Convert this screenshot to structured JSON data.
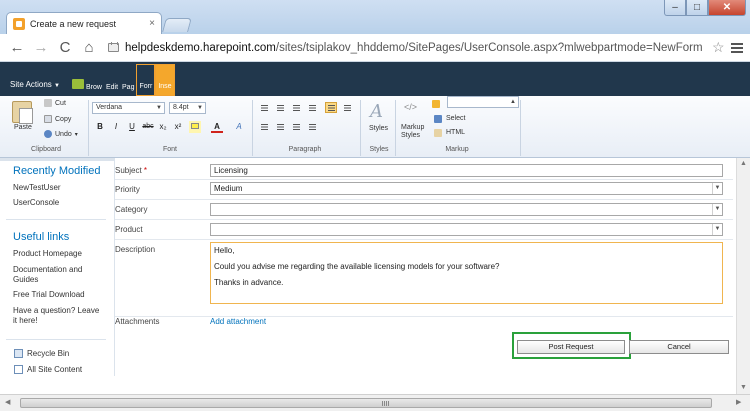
{
  "browser": {
    "tab_title": "Create a new request",
    "tab_close": "×",
    "url_host": "helpdeskdemo.harepoint.com",
    "url_path": "/sites/tsiplakov_hhddemo/SitePages/UserConsole.aspx?mlwebpartmode=NewForm",
    "back_glyph": "←",
    "forward_glyph": "→",
    "reload_glyph": "C",
    "home_glyph": "⌂",
    "star_glyph": "☆",
    "minimize_glyph": "–",
    "maximize_glyph": "□",
    "close_glyph": "✕"
  },
  "ribbon": {
    "site_actions": "Site Actions",
    "tabs": [
      {
        "label": "Brow"
      },
      {
        "label": "Edit"
      },
      {
        "label": "Pag"
      },
      {
        "label": "Forr"
      },
      {
        "label": "Inse"
      }
    ],
    "clipboard": {
      "paste": "Paste",
      "cut": "Cut",
      "copy": "Copy",
      "undo": "Undo",
      "group_label": "Clipboard"
    },
    "font": {
      "family": "Verdana",
      "size": "8.4pt",
      "bold": "B",
      "italic": "I",
      "underline": "U",
      "strike": "abc",
      "subscript": "x₂",
      "superscript": "x²",
      "font_color": "A",
      "clear": "A",
      "group_label": "Font"
    },
    "paragraph": {
      "group_label": "Paragraph"
    },
    "styles": {
      "label": "Styles",
      "group_label": "Styles"
    },
    "markup": {
      "markup_styles": "Markup",
      "markup_styles2": "Styles",
      "select": "Select",
      "html": "HTML",
      "group_label": "Markup"
    }
  },
  "quicklaunch": {
    "recently_modified_heading": "Recently Modified",
    "recent_items": [
      "NewTestUser",
      "UserConsole"
    ],
    "useful_links_heading": "Useful links",
    "useful_links": [
      "Product Homepage",
      "Documentation and Guides",
      "Free Trial Download",
      "Have a question? Leave it here!"
    ],
    "recycle_bin": "Recycle Bin",
    "all_site_content": "All Site Content"
  },
  "form": {
    "subject_label": "Subject",
    "required_marker": "*",
    "subject_value": "Licensing",
    "priority_label": "Priority",
    "priority_value": "Medium",
    "category_label": "Category",
    "category_value": "",
    "product_label": "Product",
    "product_value": "",
    "description_label": "Description",
    "description_lines": [
      "Hello,",
      "Could you advise me regarding the available licensing models for your software?",
      "Thanks in advance."
    ],
    "attachments_label": "Attachments",
    "add_attachment": "Add attachment",
    "post_button": "Post Request",
    "cancel_button": "Cancel"
  },
  "colors": {
    "link_blue": "#0072bc",
    "ribbon_dark": "#21374c",
    "context_tab_orange": "#f4a72c",
    "highlight_green": "#2aa13b"
  }
}
